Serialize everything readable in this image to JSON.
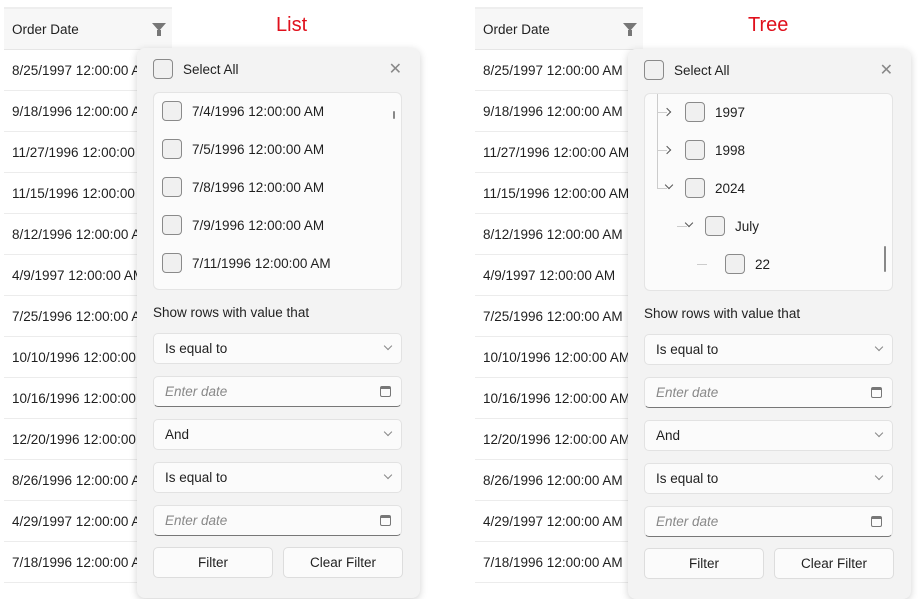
{
  "panels": [
    {
      "title": "List",
      "column_header": "Order Date",
      "rows": [
        "8/25/1997 12:00:00 AM",
        "9/18/1996 12:00:00 AM",
        "11/27/1996 12:00:00 AM",
        "11/15/1996 12:00:00 AM",
        "8/12/1996 12:00:00 AM",
        "4/9/1997 12:00:00 AM",
        "7/25/1996 12:00:00 AM",
        "10/10/1996 12:00:00 AM",
        "10/16/1996 12:00:00 AM",
        "12/20/1996 12:00:00 AM",
        "8/26/1996 12:00:00 AM",
        "4/29/1997 12:00:00 AM",
        "7/18/1996 12:00:00 AM"
      ],
      "select_all": "Select All",
      "items": [
        "7/4/1996 12:00:00 AM",
        "7/5/1996 12:00:00 AM",
        "7/8/1996 12:00:00 AM",
        "7/9/1996 12:00:00 AM",
        "7/11/1996 12:00:00 AM"
      ],
      "show_rows_label": "Show rows with value that",
      "operator1": "Is equal to",
      "date_placeholder1": "Enter date",
      "logic": "And",
      "operator2": "Is equal to",
      "date_placeholder2": "Enter date",
      "filter_button": "Filter",
      "clear_button": "Clear Filter"
    },
    {
      "title": "Tree",
      "column_header": "Order Date",
      "rows": [
        "8/25/1997 12:00:00 AM",
        "9/18/1996 12:00:00 AM",
        "11/27/1996 12:00:00 AM",
        "11/15/1996 12:00:00 AM",
        "8/12/1996 12:00:00 AM",
        "4/9/1997 12:00:00 AM",
        "7/25/1996 12:00:00 AM",
        "10/10/1996 12:00:00 AM",
        "10/16/1996 12:00:00 AM",
        "12/20/1996 12:00:00 AM",
        "8/26/1996 12:00:00 AM",
        "4/29/1997 12:00:00 AM",
        "7/18/1996 12:00:00 AM"
      ],
      "select_all": "Select All",
      "items": [
        {
          "label": "1997",
          "level": 0,
          "state": "collapsed"
        },
        {
          "label": "1998",
          "level": 0,
          "state": "collapsed"
        },
        {
          "label": "2024",
          "level": 0,
          "state": "expanded"
        },
        {
          "label": "July",
          "level": 1,
          "state": "expanded"
        },
        {
          "label": "22",
          "level": 2,
          "state": "leaf"
        }
      ],
      "show_rows_label": "Show rows with value that",
      "operator1": "Is equal to",
      "date_placeholder1": "Enter date",
      "logic": "And",
      "operator2": "Is equal to",
      "date_placeholder2": "Enter date",
      "filter_button": "Filter",
      "clear_button": "Clear Filter"
    }
  ],
  "colors": {
    "title": "#e0101c"
  }
}
